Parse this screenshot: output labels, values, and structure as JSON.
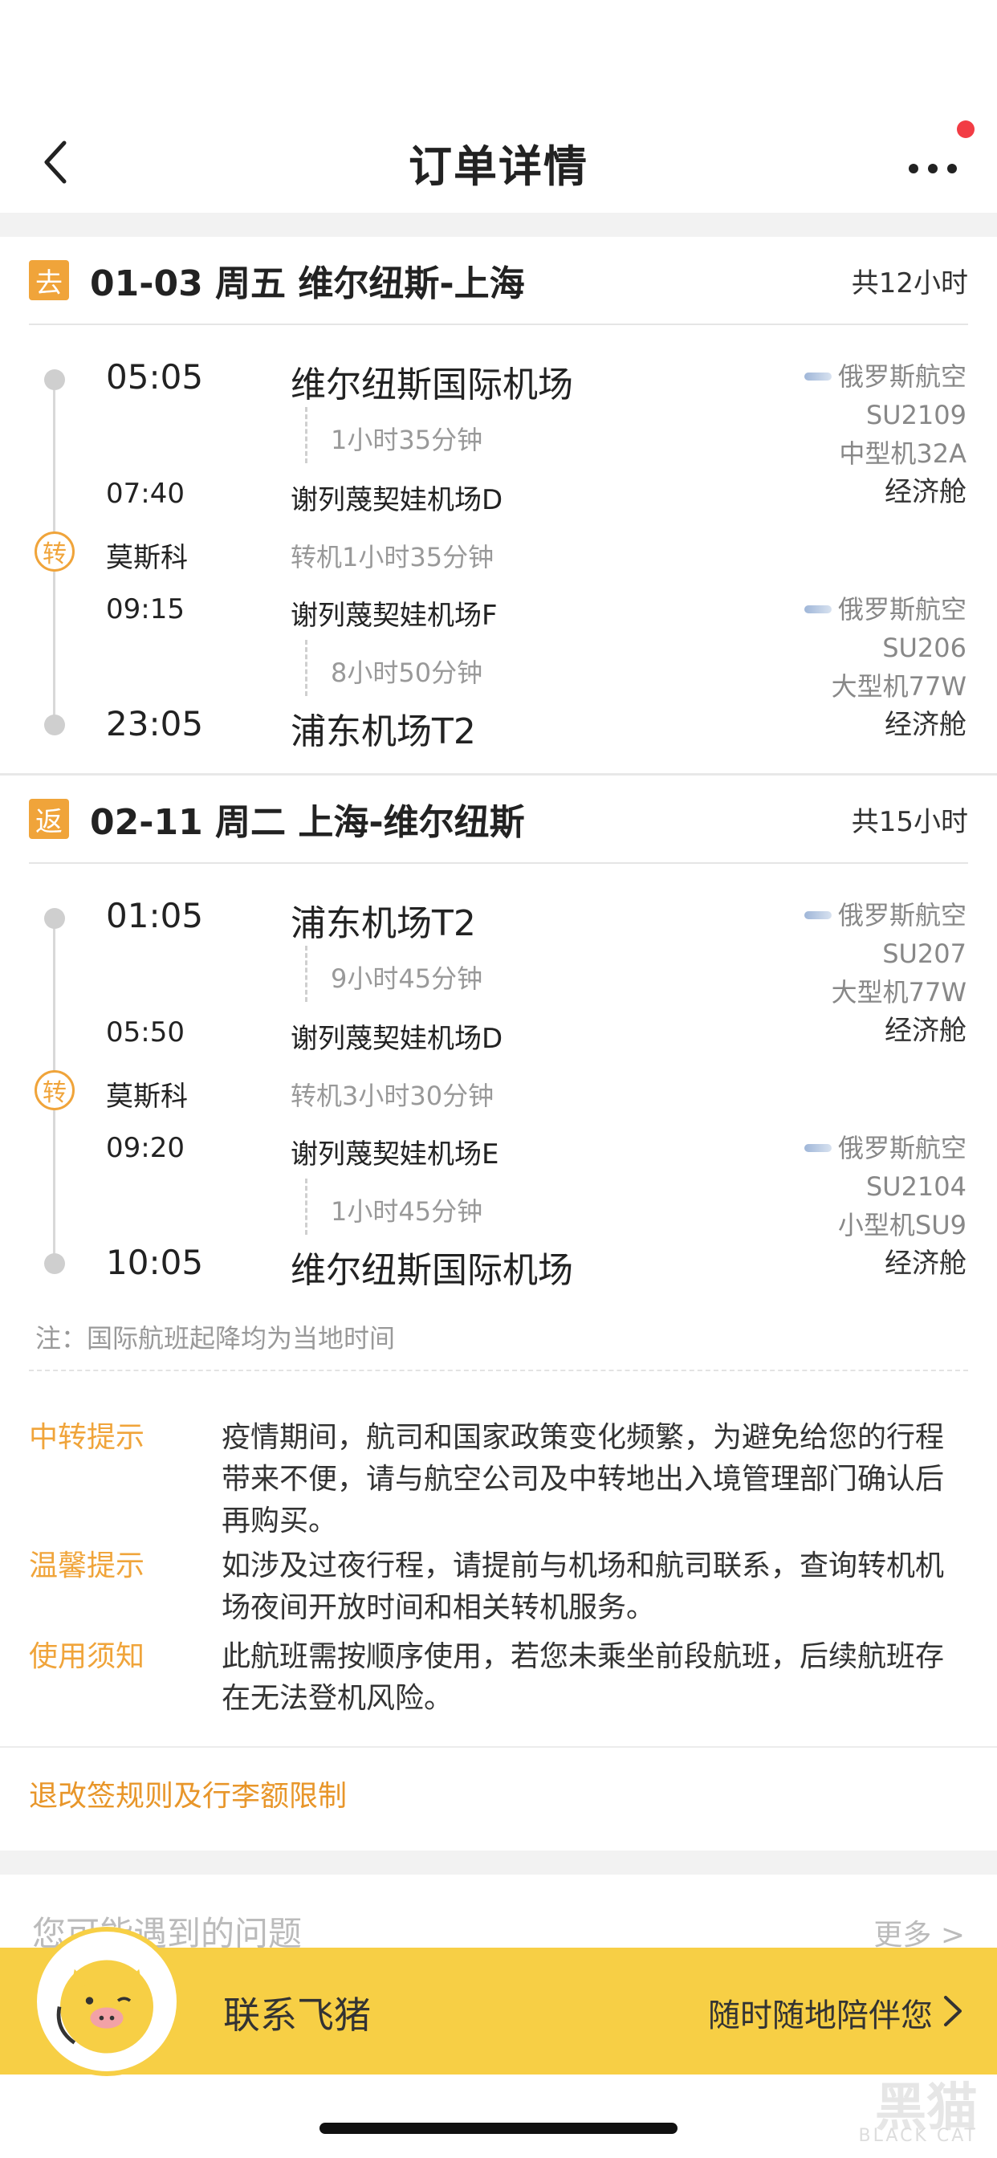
{
  "nav": {
    "title": "订单详情"
  },
  "outbound": {
    "badge": "去",
    "title": "01-03 周五 维尔纽斯-上海",
    "total": "共12小时",
    "dep_time": "05:05",
    "dep_airport": "维尔纽斯国际机场",
    "leg1_duration": "1小时35分钟",
    "arr1_time": "07:40",
    "arr1_airport": "谢列蔑契娃机场D",
    "transfer_city": "莫斯科",
    "transfer_text": "转机1小时35分钟",
    "dep2_time": "09:15",
    "dep2_airport": "谢列蔑契娃机场F",
    "leg2_duration": "8小时50分钟",
    "arr_time": "23:05",
    "arr_airport": "浦东机场T2",
    "leg1": {
      "airline": "俄罗斯航空",
      "flight": "SU2109",
      "aircraft": "中型机32A",
      "cabin": "经济舱"
    },
    "leg2": {
      "airline": "俄罗斯航空",
      "flight": "SU206",
      "aircraft": "大型机77W",
      "cabin": "经济舱"
    }
  },
  "return": {
    "badge": "返",
    "title": "02-11 周二 上海-维尔纽斯",
    "total": "共15小时",
    "dep_time": "01:05",
    "dep_airport": "浦东机场T2",
    "leg1_duration": "9小时45分钟",
    "arr1_time": "05:50",
    "arr1_airport": "谢列蔑契娃机场D",
    "transfer_city": "莫斯科",
    "transfer_text": "转机3小时30分钟",
    "dep2_time": "09:20",
    "dep2_airport": "谢列蔑契娃机场E",
    "leg2_duration": "1小时45分钟",
    "arr_time": "10:05",
    "arr_airport": "维尔纽斯国际机场",
    "leg1": {
      "airline": "俄罗斯航空",
      "flight": "SU207",
      "aircraft": "大型机77W",
      "cabin": "经济舱"
    },
    "leg2": {
      "airline": "俄罗斯航空",
      "flight": "SU2104",
      "aircraft": "小型机SU9",
      "cabin": "经济舱"
    }
  },
  "transfer_icon_text": "转",
  "note": "注：国际航班起降均为当地时间",
  "tips": [
    {
      "label": "中转提示",
      "text": "疫情期间，航司和国家政策变化频繁，为避免给您的行程带来不便，请与航空公司及中转地出入境管理部门确认后再购买。"
    },
    {
      "label": "温馨提示",
      "text": "如涉及过夜行程，请提前与机场和航司联系，查询转机机场夜间开放时间和相关转机服务。"
    },
    {
      "label": "使用须知",
      "text": "此航班需按顺序使用，若您未乘坐前段航班，后续航班存在无法登机风险。"
    }
  ],
  "rules_link": "退改签规则及行李额限制",
  "faq": {
    "title": "您可能遇到的问题",
    "more": "更多 >"
  },
  "contact": {
    "label": "联系飞猪",
    "sub": "随时随地陪伴您"
  },
  "watermark": {
    "text": "黑猫",
    "sub": "BLACK CAT"
  },
  "colors": {
    "accent": "#f0a43a",
    "bar": "#f7cf45",
    "badge_dot": "#f23c44"
  }
}
